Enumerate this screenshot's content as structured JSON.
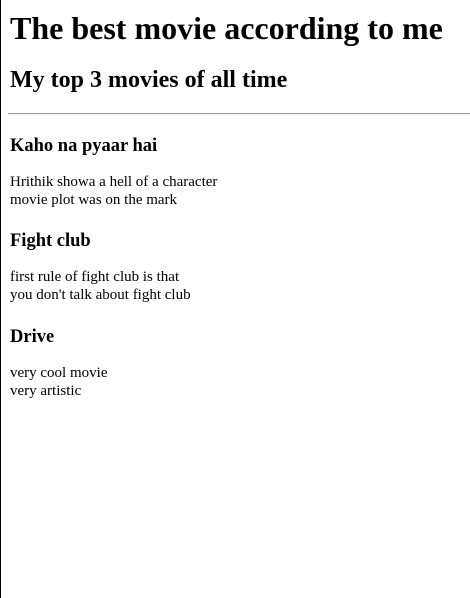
{
  "page": {
    "title": "The best movie according to me",
    "subtitle": "My top 3 movies of all time"
  },
  "movies": [
    {
      "title": "Kaho na pyaar hai",
      "lines": [
        "Hrithik showa a hell of a character",
        "movie plot was on the mark"
      ]
    },
    {
      "title": "Fight club",
      "lines": [
        "first rule of fight club is that",
        "you don't talk about fight club"
      ]
    },
    {
      "title": "Drive",
      "lines": [
        "very cool movie",
        "very artistic"
      ]
    }
  ]
}
